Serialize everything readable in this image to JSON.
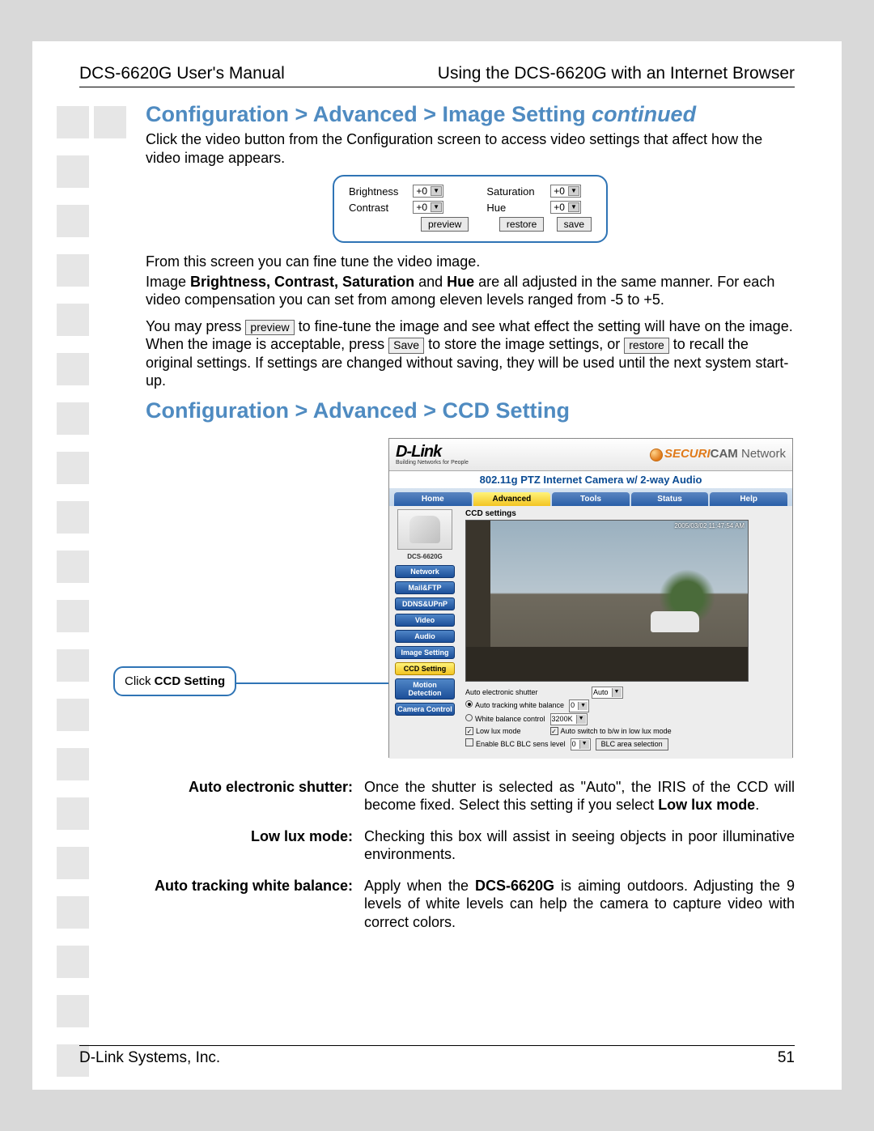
{
  "header": {
    "left": "DCS-6620G User's Manual",
    "right": "Using the DCS-6620G with an Internet Browser"
  },
  "section1": {
    "title_main": "Configuration > Advanced > Image Setting ",
    "title_cont": "continued",
    "p1": "Click the video button from the Configuration screen to access video settings that affect how the video image appears.",
    "panel": {
      "labels": {
        "brightness": "Brightness",
        "contrast": "Contrast",
        "saturation": "Saturation",
        "hue": "Hue"
      },
      "value": "+0",
      "btn_preview": "preview",
      "btn_restore": "restore",
      "btn_save": "save"
    },
    "p2": "From this screen you can fine tune the video image.",
    "p3a": "Image ",
    "p3b": "Brightness, Contrast, Saturation",
    "p3c": " and ",
    "p3d": "Hue",
    "p3e": " are all adjusted in the same manner. For each video compensation you can set from among eleven levels ranged from -5 to  +5.",
    "p4a": "You may press ",
    "p4btn1": "preview",
    "p4b": " to fine-tune the image and see what effect the setting will have on the image. When the image is acceptable, press ",
    "p4btn2": "Save",
    "p4c": " to store the image settings, or ",
    "p4btn3": "restore",
    "p4d": " to recall the original settings. If settings are changed without saving, they will be used until the next system start-up."
  },
  "section2": {
    "title": "Configuration > Advanced > CCD Setting",
    "callout_pre": "Click ",
    "callout_b": "CCD Setting",
    "ui": {
      "logo": "D-Link",
      "logo_sub": "Building Networks for People",
      "brand1": "SECURI",
      "brand2": "CAM",
      "brand3": " Network",
      "subtitle": "802.11g PTZ Internet Camera w/ 2-way Audio",
      "tabs": [
        "Home",
        "Advanced",
        "Tools",
        "Status",
        "Help"
      ],
      "active_tab": 1,
      "model": "DCS-6620G",
      "side": [
        "Network",
        "Mail&FTP",
        "DDNS&UPnP",
        "Video",
        "Audio",
        "Image Setting",
        "CCD Setting",
        "Motion Detection",
        "Camera Control"
      ],
      "active_side": 6,
      "main_title": "CCD settings",
      "timestamp": "2005/03/02 11:47:54 AM",
      "settings": {
        "aes_label": "Auto electronic shutter",
        "aes_value": "Auto",
        "atwb_label": "Auto tracking white balance",
        "atwb_value": "0",
        "wbc_label": "White balance control",
        "wbc_value": "3200K",
        "lowlux_label": "Low lux mode",
        "autobw_label": "Auto switch to b/w in low lux mode",
        "blc_label": "Enable BLC    BLC sens level",
        "blc_value": "0",
        "blc_btn": "BLC area selection"
      }
    }
  },
  "defs": {
    "d1_t": "Auto electronic shutter:",
    "d1_a": "Once the shutter is selected as \"Auto\", the IRIS of the CCD will become fixed. Select this setting if you select ",
    "d1_b": "Low lux mode",
    "d1_c": ".",
    "d2_t": "Low lux mode:",
    "d2": "Checking this box will assist in seeing objects in poor illuminative environments.",
    "d3_t": "Auto tracking white balance:",
    "d3_a": "Apply when the ",
    "d3_b": "DCS-6620G",
    "d3_c": " is aiming outdoors. Adjusting the 9 levels of white levels can help the camera to capture video with correct colors."
  },
  "footer": {
    "left": "D-Link Systems, Inc.",
    "right": "51"
  }
}
